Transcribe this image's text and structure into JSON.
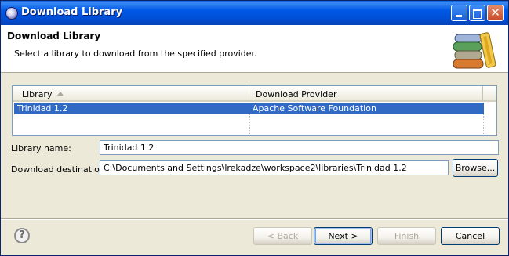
{
  "window": {
    "title": "Download Library",
    "icon": "eclipse-icon"
  },
  "header": {
    "title": "Download Library",
    "description": "Select a library to download from the specified provider.",
    "icon": "books-icon"
  },
  "table": {
    "columns": [
      "Library",
      "Download Provider"
    ],
    "rows": [
      {
        "library": "Trinidad 1.2",
        "provider": "Apache Software Foundation",
        "selected": true
      }
    ]
  },
  "form": {
    "library_name_label": "Library name:",
    "library_name_value": "Trinidad 1.2",
    "destination_label": "Download destination:",
    "destination_value": "C:\\Documents and Settings\\lrekadze\\workspace2\\libraries\\Trinidad 1.2",
    "browse_label": "Browse..."
  },
  "buttons": {
    "back": "< Back",
    "next": "Next >",
    "finish": "Finish",
    "cancel": "Cancel",
    "help": "?"
  },
  "colors": {
    "selection": "#316ac5",
    "titlebar": "#0058e6"
  }
}
